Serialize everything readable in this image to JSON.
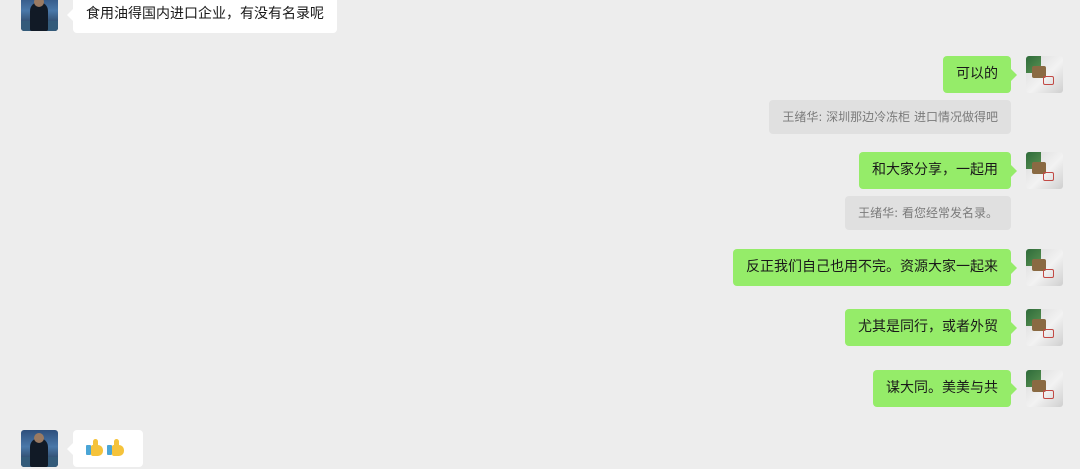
{
  "messages": [
    {
      "sender": "other",
      "text": "食用油得国内进口企业，有没有名录呢"
    },
    {
      "sender": "self",
      "text": "可以的"
    },
    {
      "sender": "self",
      "text": "和大家分享，一起用"
    },
    {
      "sender": "self",
      "text": "反正我们自己也用不完。资源大家一起来"
    },
    {
      "sender": "self",
      "text": "尤其是同行，或者外贸"
    },
    {
      "sender": "self",
      "text": "谋大同。美美与共"
    },
    {
      "sender": "other",
      "emoji": [
        "thumbs-up-icon",
        "thumbs-up-icon"
      ]
    }
  ],
  "quotes": [
    {
      "text": "王绪华: 深圳那边冷冻柜 进口情况做得吧"
    },
    {
      "text": "王绪华: 看您经常发名录。"
    }
  ],
  "colors": {
    "background": "#ededed",
    "self_bubble": "#95ec69",
    "other_bubble": "#ffffff",
    "quote_bubble": "#e0e0e0"
  }
}
